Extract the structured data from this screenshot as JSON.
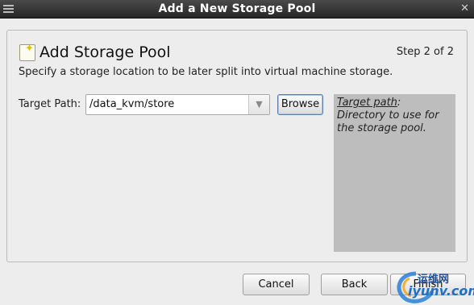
{
  "window": {
    "title": "Add a New Storage Pool",
    "close_glyph": "✕",
    "menu_icon": "window-menu-icon"
  },
  "header": {
    "icon": "storage-pool-icon",
    "title": "Add Storage Pool",
    "step": "Step 2 of 2",
    "subtitle": "Specify a storage location to be later split into virtual machine storage."
  },
  "form": {
    "target_path_label": "Target Path:",
    "target_path_value": "/data_kvm/store",
    "browse_label": "Browse"
  },
  "help": {
    "term": "Target path",
    "text": ": Directory to use for the storage pool."
  },
  "buttons": {
    "cancel": "Cancel",
    "back": "Back",
    "finish": "Finish"
  },
  "watermark": {
    "cn": "运维网",
    "en": "iyunv.com"
  }
}
